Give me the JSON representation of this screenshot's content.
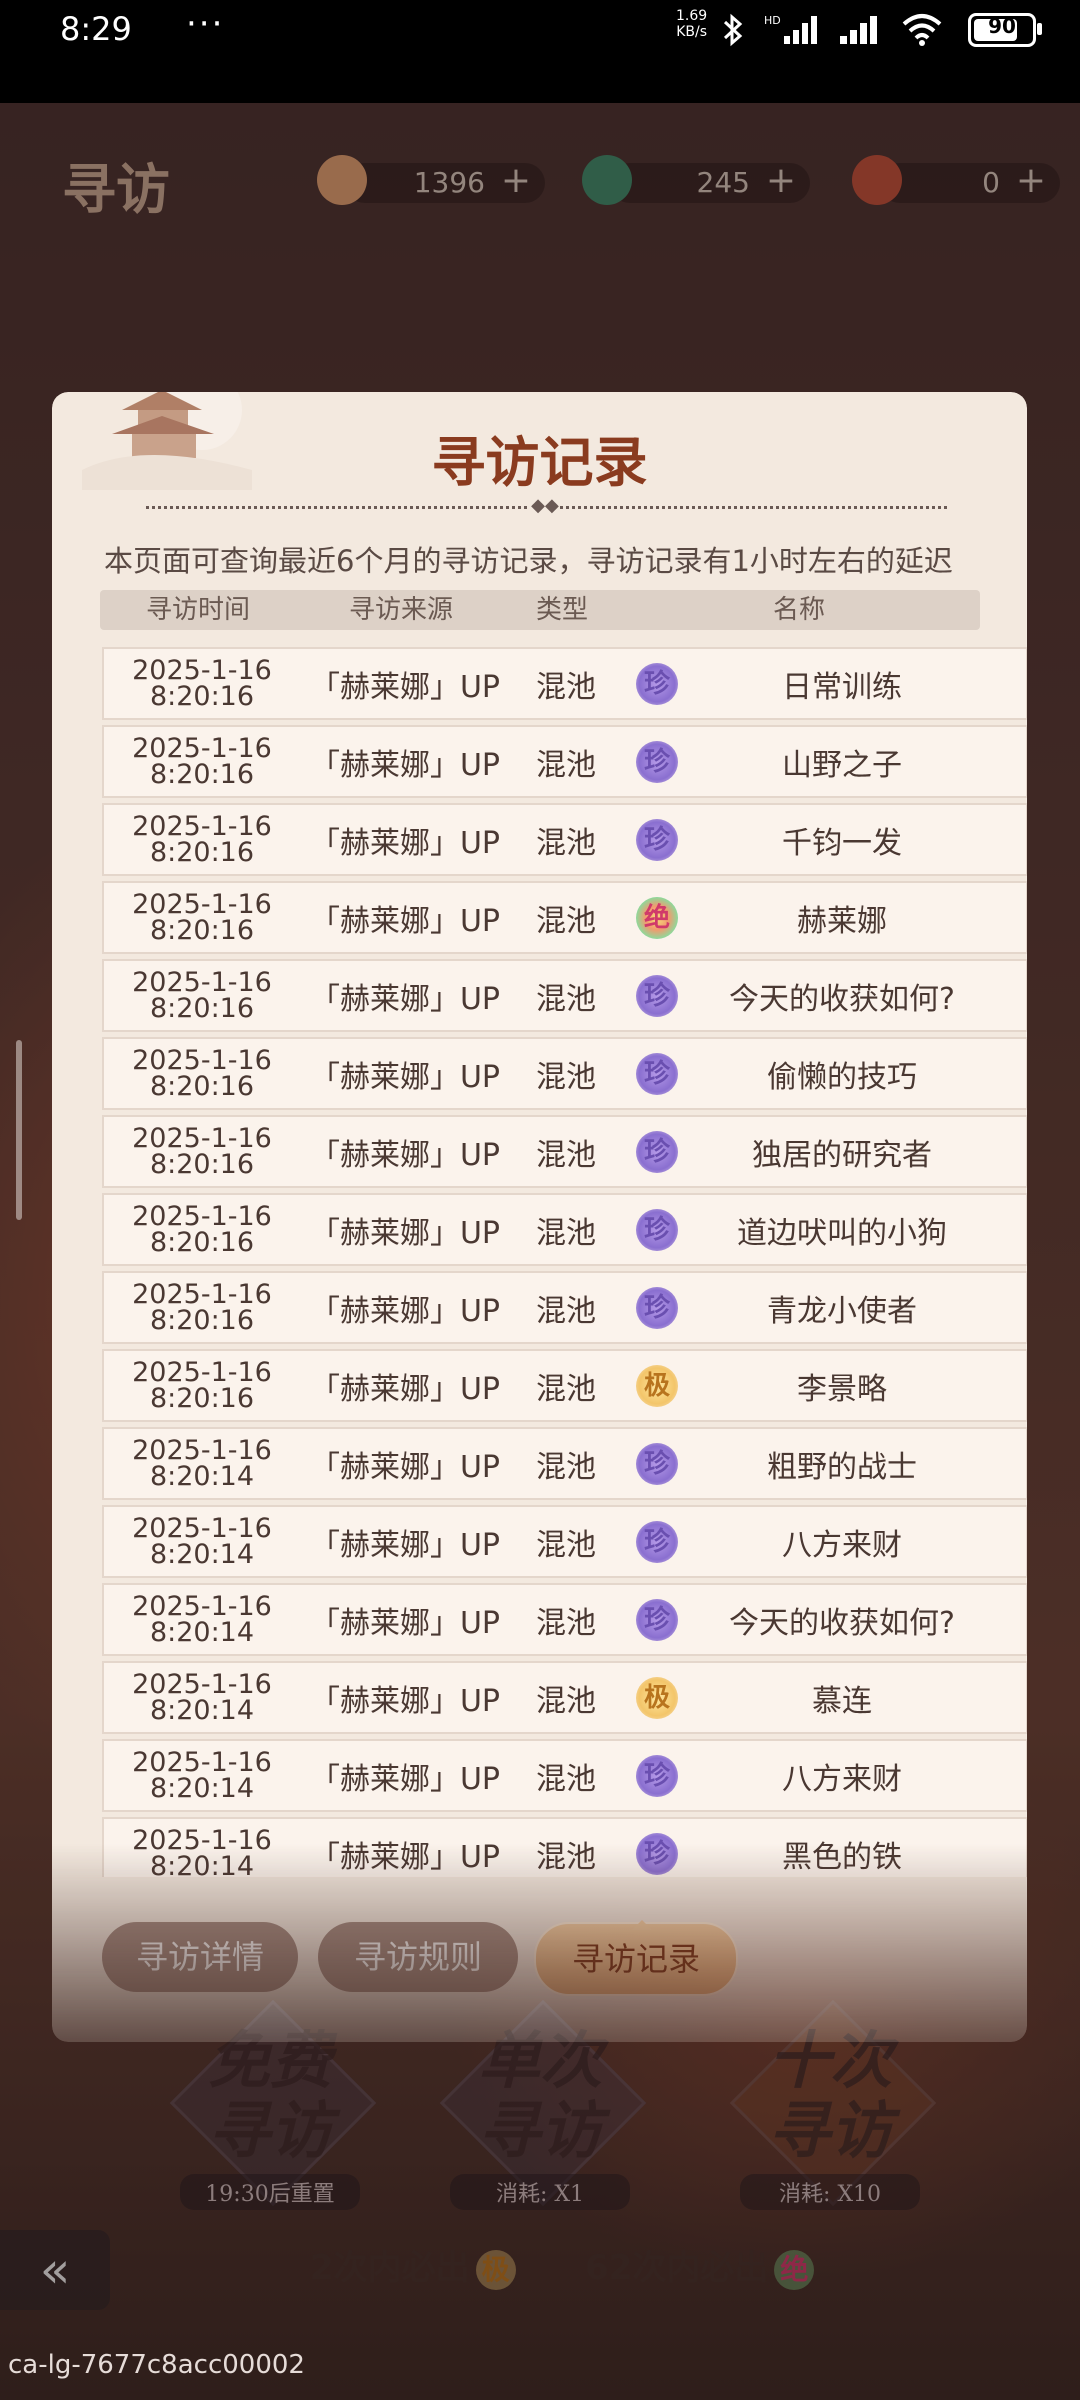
{
  "status_bar": {
    "time": "8:29",
    "dots": "···",
    "speed_value": "1.69",
    "speed_unit": "KB/s",
    "battery": "90"
  },
  "game": {
    "title": "寻访",
    "resources": [
      {
        "value": "1396",
        "color": "#e0a070"
      },
      {
        "value": "245",
        "color": "#3f8a6a"
      },
      {
        "value": "0",
        "color": "#c0503a"
      }
    ],
    "pull_buttons": [
      {
        "line1": "免费",
        "line2": "寻访",
        "sub": "19:30后重置"
      },
      {
        "line1": "单次",
        "line2": "寻访",
        "sub": "消耗: X1"
      },
      {
        "line1": "十次",
        "line2": "寻访",
        "sub": "消耗: X10"
      }
    ],
    "pity": [
      {
        "text": "2次内必出",
        "badge": "极"
      },
      {
        "text": "62次内必出",
        "badge": "绝"
      }
    ],
    "back_label": "«"
  },
  "modal": {
    "title": "寻访记录",
    "notice": "本页面可查询最近6个月的寻访记录，寻访记录有1小时左右的延迟",
    "columns": [
      "寻访时间",
      "寻访来源",
      "类型",
      "名称"
    ],
    "rows": [
      {
        "date": "2025-1-16",
        "time": "8:20:16",
        "source": "「赫莱娜」UP",
        "type": "混池",
        "rarity": "珍",
        "rarity_class": "zhen",
        "name": "日常训练"
      },
      {
        "date": "2025-1-16",
        "time": "8:20:16",
        "source": "「赫莱娜」UP",
        "type": "混池",
        "rarity": "珍",
        "rarity_class": "zhen",
        "name": "山野之子"
      },
      {
        "date": "2025-1-16",
        "time": "8:20:16",
        "source": "「赫莱娜」UP",
        "type": "混池",
        "rarity": "珍",
        "rarity_class": "zhen",
        "name": "千钧一发"
      },
      {
        "date": "2025-1-16",
        "time": "8:20:16",
        "source": "「赫莱娜」UP",
        "type": "混池",
        "rarity": "绝",
        "rarity_class": "jue",
        "name": "赫莱娜"
      },
      {
        "date": "2025-1-16",
        "time": "8:20:16",
        "source": "「赫莱娜」UP",
        "type": "混池",
        "rarity": "珍",
        "rarity_class": "zhen",
        "name": "今天的收获如何?"
      },
      {
        "date": "2025-1-16",
        "time": "8:20:16",
        "source": "「赫莱娜」UP",
        "type": "混池",
        "rarity": "珍",
        "rarity_class": "zhen",
        "name": "偷懒的技巧"
      },
      {
        "date": "2025-1-16",
        "time": "8:20:16",
        "source": "「赫莱娜」UP",
        "type": "混池",
        "rarity": "珍",
        "rarity_class": "zhen",
        "name": "独居的研究者"
      },
      {
        "date": "2025-1-16",
        "time": "8:20:16",
        "source": "「赫莱娜」UP",
        "type": "混池",
        "rarity": "珍",
        "rarity_class": "zhen",
        "name": "道边吠叫的小狗"
      },
      {
        "date": "2025-1-16",
        "time": "8:20:16",
        "source": "「赫莱娜」UP",
        "type": "混池",
        "rarity": "珍",
        "rarity_class": "zhen",
        "name": "青龙小使者"
      },
      {
        "date": "2025-1-16",
        "time": "8:20:16",
        "source": "「赫莱娜」UP",
        "type": "混池",
        "rarity": "极",
        "rarity_class": "ji",
        "name": "李景略"
      },
      {
        "date": "2025-1-16",
        "time": "8:20:14",
        "source": "「赫莱娜」UP",
        "type": "混池",
        "rarity": "珍",
        "rarity_class": "zhen",
        "name": "粗野的战士"
      },
      {
        "date": "2025-1-16",
        "time": "8:20:14",
        "source": "「赫莱娜」UP",
        "type": "混池",
        "rarity": "珍",
        "rarity_class": "zhen",
        "name": "八方来财"
      },
      {
        "date": "2025-1-16",
        "time": "8:20:14",
        "source": "「赫莱娜」UP",
        "type": "混池",
        "rarity": "珍",
        "rarity_class": "zhen",
        "name": "今天的收获如何?"
      },
      {
        "date": "2025-1-16",
        "time": "8:20:14",
        "source": "「赫莱娜」UP",
        "type": "混池",
        "rarity": "极",
        "rarity_class": "ji",
        "name": "慕连"
      },
      {
        "date": "2025-1-16",
        "time": "8:20:14",
        "source": "「赫莱娜」UP",
        "type": "混池",
        "rarity": "珍",
        "rarity_class": "zhen",
        "name": "八方来财"
      },
      {
        "date": "2025-1-16",
        "time": "8:20:14",
        "source": "「赫莱娜」UP",
        "type": "混池",
        "rarity": "珍",
        "rarity_class": "zhen",
        "name": "黑色的铁"
      }
    ],
    "tabs": [
      {
        "label": "寻访详情",
        "active": false
      },
      {
        "label": "寻访规则",
        "active": false
      },
      {
        "label": "寻访记录",
        "active": true
      }
    ]
  },
  "watermark": "ca-lg-7677c8acc00002"
}
